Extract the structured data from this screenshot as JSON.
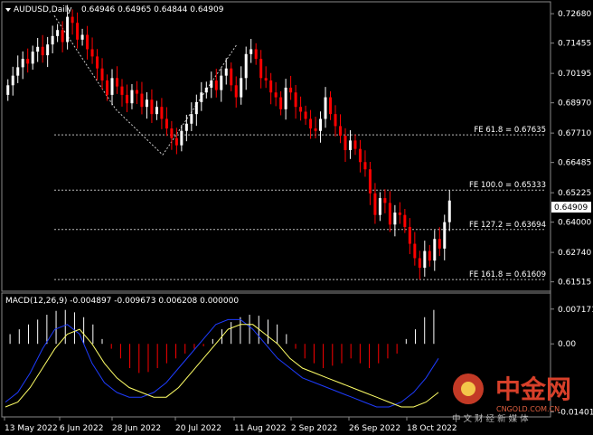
{
  "symbol_header": {
    "symbol": "AUDUSD,Daily",
    "ohlc": "0.64946 0.64965 0.64844 0.64909"
  },
  "price_axis": {
    "ticks": [
      "0.72680",
      "0.71455",
      "0.70195",
      "0.68970",
      "0.67710",
      "0.66485",
      "0.65225",
      "0.64000",
      "0.62740",
      "0.61515"
    ],
    "current_price": "0.64909"
  },
  "fib_levels": [
    {
      "label": "FE 61.8 = 0.67635",
      "value": 0.67635
    },
    {
      "label": "FE 100.0 = 0.65333",
      "value": 0.65333
    },
    {
      "label": "FE 127.2 = 0.63694",
      "value": 0.63694
    },
    {
      "label": "FE 161.8 = 0.61609",
      "value": 0.61609
    }
  ],
  "macd": {
    "header": "MACD(12,26,9) -0.004897 -0.009673 0.006208 0.000000",
    "ticks": [
      "0.007171",
      "0.00",
      "-0.01401"
    ]
  },
  "date_axis": [
    "13 May 2022",
    "6 Jun 2022",
    "28 Jun 2022",
    "20 Jul 2022",
    "11 Aug 2022",
    "2 Sep 2022",
    "26 Sep 2022",
    "18 Oct 2022"
  ],
  "watermark": {
    "brand": "中金网",
    "url": "CNGOLD.COM.CN",
    "tagline": "中 文 财 经 新 媒 体"
  },
  "colors": {
    "background": "#000000",
    "bull_candle": "#ffffff",
    "bear_candle": "#ff0000",
    "macd_hist_pos": "#ffffff",
    "macd_hist_neg": "#ff0000",
    "macd_line": "#1e3cff",
    "signal_line": "#ffff66",
    "fib_line": "#bbbbbb",
    "accent_watermark": "#d8402a"
  },
  "chart_data": {
    "type": "candlestick",
    "title": "AUDUSD,Daily",
    "ylim": [
      0.612,
      0.731
    ],
    "fib_levels": [
      0.67635,
      0.65333,
      0.63694,
      0.61609
    ],
    "closes": [
      0.697,
      0.701,
      0.7045,
      0.708,
      0.706,
      0.711,
      0.713,
      0.7095,
      0.714,
      0.7175,
      0.72,
      0.715,
      0.7255,
      0.723,
      0.716,
      0.718,
      0.712,
      0.709,
      0.704,
      0.699,
      0.693,
      0.7,
      0.6965,
      0.693,
      0.6895,
      0.695,
      0.6935,
      0.688,
      0.691,
      0.685,
      0.688,
      0.683,
      0.679,
      0.675,
      0.672,
      0.678,
      0.681,
      0.685,
      0.69,
      0.694,
      0.696,
      0.699,
      0.695,
      0.701,
      0.704,
      0.697,
      0.692,
      0.7,
      0.71,
      0.712,
      0.708,
      0.7,
      0.699,
      0.694,
      0.692,
      0.687,
      0.696,
      0.694,
      0.688,
      0.686,
      0.683,
      0.679,
      0.678,
      0.683,
      0.692,
      0.685,
      0.68,
      0.676,
      0.67,
      0.674,
      0.6705,
      0.665,
      0.662,
      0.652,
      0.643,
      0.65,
      0.648,
      0.639,
      0.644,
      0.643,
      0.638,
      0.631,
      0.625,
      0.621,
      0.628,
      0.624,
      0.633,
      0.629,
      0.64,
      0.649
    ],
    "macd_histogram": [
      0.002,
      0.003,
      0.004,
      0.005,
      0.006,
      0.0068,
      0.007,
      0.0065,
      0.0055,
      0.004,
      0.001,
      -0.001,
      -0.003,
      -0.005,
      -0.006,
      -0.0058,
      -0.005,
      -0.004,
      -0.003,
      -0.002,
      -0.001,
      -0.0005,
      0.001,
      0.003,
      0.0045,
      0.0055,
      0.006,
      0.0058,
      0.005,
      0.004,
      0.002,
      -0.001,
      -0.003,
      -0.004,
      -0.005,
      -0.0045,
      -0.004,
      -0.003,
      -0.004,
      -0.005,
      -0.004,
      -0.003,
      -0.002,
      0.001,
      0.003,
      0.0055,
      0.007
    ],
    "macd_line": [
      -0.012,
      -0.01,
      -0.006,
      -0.001,
      0.003,
      0.004,
      0.002,
      -0.004,
      -0.008,
      -0.01,
      -0.011,
      -0.011,
      -0.01,
      -0.008,
      -0.005,
      -0.002,
      0.001,
      0.004,
      0.005,
      0.005,
      0.003,
      0.0,
      -0.003,
      -0.005,
      -0.007,
      -0.008,
      -0.009,
      -0.01,
      -0.011,
      -0.012,
      -0.013,
      -0.013,
      -0.012,
      -0.01,
      -0.007,
      -0.003
    ],
    "signal_line": [
      -0.013,
      -0.012,
      -0.009,
      -0.005,
      -0.001,
      0.002,
      0.003,
      0.0,
      -0.004,
      -0.007,
      -0.009,
      -0.01,
      -0.011,
      -0.011,
      -0.009,
      -0.006,
      -0.003,
      0.0,
      0.003,
      0.004,
      0.004,
      0.002,
      0.0,
      -0.003,
      -0.005,
      -0.006,
      -0.007,
      -0.008,
      -0.009,
      -0.01,
      -0.011,
      -0.012,
      -0.013,
      -0.013,
      -0.012,
      -0.01
    ]
  }
}
